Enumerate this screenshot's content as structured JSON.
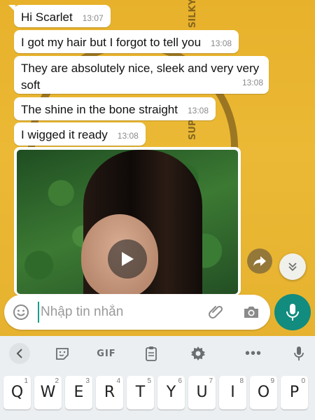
{
  "messages": [
    {
      "text": "Hi Scarlet",
      "time": "13:07"
    },
    {
      "text": "I got my hair but I forgot to tell you",
      "time": "13:08"
    },
    {
      "text": "They are absolutely nice, sleek and very very soft",
      "time": "13:08"
    },
    {
      "text": "The shine in the bone straight",
      "time": "13:08"
    },
    {
      "text": "I wigged it ready",
      "time": "13:08"
    }
  ],
  "wallpaper": {
    "side_text_1": "SILKY",
    "side_text_2": "SUP"
  },
  "input": {
    "placeholder": "Nhập tin nhắn"
  },
  "keyboard": {
    "gif_label": "GIF",
    "more_label": "•••",
    "keys": [
      {
        "main": "Q",
        "hint": "1"
      },
      {
        "main": "W",
        "hint": "2"
      },
      {
        "main": "E",
        "hint": "3"
      },
      {
        "main": "R",
        "hint": "4"
      },
      {
        "main": "T",
        "hint": "5"
      },
      {
        "main": "Y",
        "hint": "6"
      },
      {
        "main": "U",
        "hint": "7"
      },
      {
        "main": "I",
        "hint": "8"
      },
      {
        "main": "O",
        "hint": "9"
      },
      {
        "main": "P",
        "hint": "0"
      }
    ]
  },
  "colors": {
    "accent": "#128c7e",
    "wallpaper": "#e9b732",
    "bubble": "#ffffff"
  },
  "icons": [
    "emoji-icon",
    "paperclip-icon",
    "camera-icon",
    "microphone-icon",
    "play-icon",
    "forward-icon",
    "chevron-double-down-icon",
    "back-icon",
    "sticker-icon",
    "clipboard-icon",
    "gear-icon"
  ]
}
